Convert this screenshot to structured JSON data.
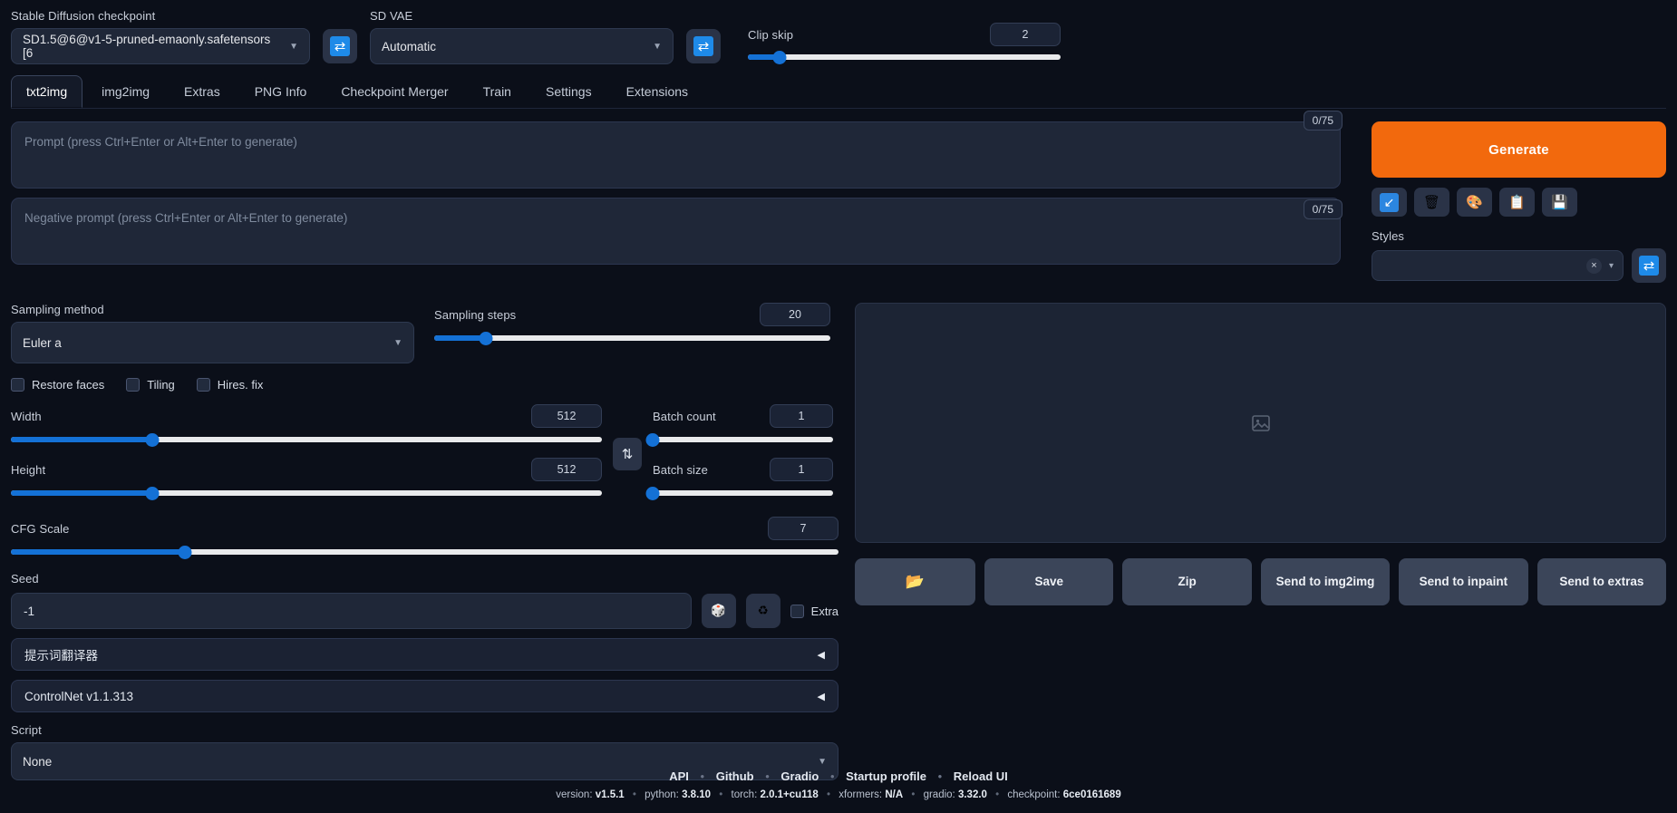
{
  "topbar": {
    "checkpoint_label": "Stable Diffusion checkpoint",
    "checkpoint_value": "SD1.5@6@v1-5-pruned-emaonly.safetensors [6",
    "checkpoint_refresh_icon": "refresh-icon",
    "vae_label": "SD VAE",
    "vae_value": "Automatic",
    "vae_refresh_icon": "refresh-icon",
    "clip_skip_label": "Clip skip",
    "clip_skip_value": "2",
    "clip_skip_percent": 10
  },
  "tabs": [
    {
      "label": "txt2img",
      "active": true
    },
    {
      "label": "img2img",
      "active": false
    },
    {
      "label": "Extras",
      "active": false
    },
    {
      "label": "PNG Info",
      "active": false
    },
    {
      "label": "Checkpoint Merger",
      "active": false
    },
    {
      "label": "Train",
      "active": false
    },
    {
      "label": "Settings",
      "active": false
    },
    {
      "label": "Extensions",
      "active": false
    }
  ],
  "prompt": {
    "placeholder": "Prompt (press Ctrl+Enter or Alt+Enter to generate)",
    "value": "",
    "token_counter": "0/75"
  },
  "negative_prompt": {
    "placeholder": "Negative prompt (press Ctrl+Enter or Alt+Enter to generate)",
    "value": "",
    "token_counter": "0/75"
  },
  "generate": {
    "label": "Generate",
    "accent_color": "#f2690d",
    "tools": [
      {
        "name": "arrow-down-left-icon",
        "glyph": "↙"
      },
      {
        "name": "trash-icon",
        "glyph": "🗑"
      },
      {
        "name": "palette-icon",
        "glyph": "🎨"
      },
      {
        "name": "clipboard-icon",
        "glyph": "📋"
      },
      {
        "name": "save-icon",
        "glyph": "💾"
      }
    ]
  },
  "styles": {
    "label": "Styles",
    "value": "",
    "clear_glyph": "×",
    "caret_glyph": "▾",
    "refresh_icon": "refresh-icon"
  },
  "settings": {
    "sampling_method_label": "Sampling method",
    "sampling_method_value": "Euler a",
    "sampling_steps_label": "Sampling steps",
    "sampling_steps_value": "20",
    "sampling_steps_percent": 13,
    "checkboxes": [
      {
        "label": "Restore faces",
        "checked": false
      },
      {
        "label": "Tiling",
        "checked": false
      },
      {
        "label": "Hires. fix",
        "checked": false
      }
    ],
    "width_label": "Width",
    "width_value": "512",
    "width_percent": 24,
    "height_label": "Height",
    "height_value": "512",
    "height_percent": 24,
    "swap_glyph": "⇅",
    "batch_count_label": "Batch count",
    "batch_count_value": "1",
    "batch_count_percent": 0,
    "batch_size_label": "Batch size",
    "batch_size_value": "1",
    "batch_size_percent": 0,
    "cfg_label": "CFG Scale",
    "cfg_value": "7",
    "cfg_percent": 21,
    "seed_label": "Seed",
    "seed_value": "-1",
    "dice_glyph": "🎲",
    "recycle_glyph": "♻",
    "extra_label": "Extra",
    "extra_checked": false,
    "accordion_translator": "提示词翻译器",
    "accordion_controlnet": "ControlNet v1.1.313",
    "accordion_arrow": "◀",
    "script_label": "Script",
    "script_value": "None"
  },
  "gallery": {
    "placeholder_icon": "image-placeholder-icon",
    "buttons": [
      {
        "name": "open-folder-button",
        "label": "📂"
      },
      {
        "name": "save-button",
        "label": "Save"
      },
      {
        "name": "zip-button",
        "label": "Zip"
      },
      {
        "name": "send-to-img2img-button",
        "label": "Send to img2img"
      },
      {
        "name": "send-to-inpaint-button",
        "label": "Send to inpaint"
      },
      {
        "name": "send-to-extras-button",
        "label": "Send to extras"
      }
    ]
  },
  "footer": {
    "links": [
      "API",
      "Github",
      "Gradio",
      "Startup profile",
      "Reload UI"
    ],
    "separator": "•",
    "meta": [
      {
        "key": "version:",
        "value": "v1.5.1"
      },
      {
        "key": "python:",
        "value": "3.8.10"
      },
      {
        "key": "torch:",
        "value": "2.0.1+cu118"
      },
      {
        "key": "xformers:",
        "value": "N/A"
      },
      {
        "key": "gradio:",
        "value": "3.32.0"
      },
      {
        "key": "checkpoint:",
        "value": "6ce0161689"
      }
    ]
  }
}
